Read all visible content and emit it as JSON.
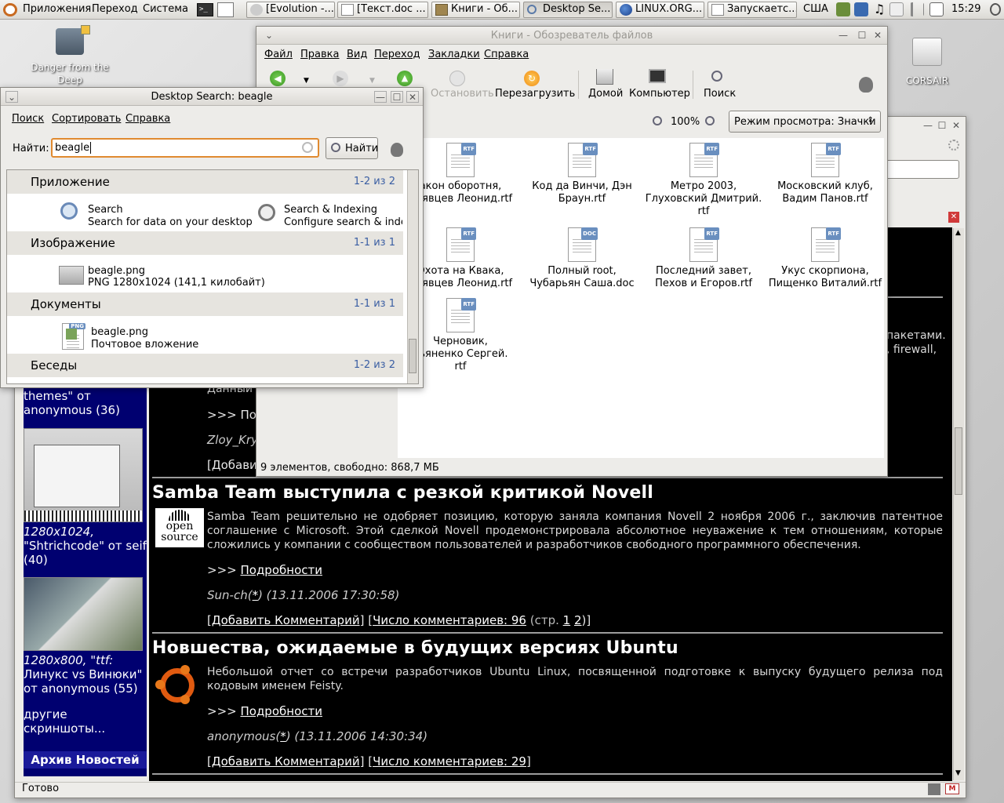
{
  "panel": {
    "menus": [
      "Приложения",
      "Переход",
      "Система"
    ],
    "tasks": [
      "[Evolution -...",
      "[Текст.doc ...",
      "Книги - Об...",
      "Desktop Se...",
      "LINUX.ORG...",
      "Запускаетс..."
    ],
    "layout": "США",
    "clock": "15:29"
  },
  "desktop": {
    "icons": [
      "Danger from the Deep",
      "CORSAIR"
    ]
  },
  "browser": {
    "status": "Готово",
    "left": {
      "t1": "themes\" от",
      "t2": "anonymous (36)",
      "t3": "1280x1024,",
      "t4": "\"Shtrichcode\" от seif",
      "t5": "(40)",
      "t6": "1280x800, \"ttf:",
      "t7": "Линукс vs Винюки\"",
      "t8": "от anonymous (55)",
      "t9": "другие скриншоты...",
      "archive": "Архив Новостей"
    },
    "frag": {
      "p1": "пакетами.",
      "p2": ", firewall,",
      "dannye": "Данный",
      "more": ">>> По",
      "author": "Zloy_Kry",
      "add": "[Добави"
    },
    "articles": [
      {
        "title": "Samba Team выступила с резкой критикой Novell",
        "logo": "open source",
        "text": "Samba Team решительно не одобряет позицию, которую заняла компания Novell 2 ноября 2006 г., заключив патентное соглашение с Microsoft. Этой сделкой Novell продемонстрировала абсолютное неуважение к тем отношениям, которые сложились у компании с сообществом пользователей и разработчиков свободного программного обеспечения.",
        "more_prefix": ">>> ",
        "more": "Подробности",
        "author": "Sun-ch",
        "star": "*",
        "date": ") (13.11.2006 17:30:58)",
        "add": "Добавить Комментарий",
        "comments": "Число комментариев: 96",
        "pages_prefix": " (стр. ",
        "p1": "1",
        "p2": "2",
        "pages_suffix": ")]"
      },
      {
        "title": "Новшества, ожидаемые в будущих версиях Ubuntu",
        "text": "Небольшой отчет со встречи разработчиков Ubuntu Linux, посвященной подготовке к выпуску будущего релиза под кодовым именем Feisty.",
        "more_prefix": ">>> ",
        "more": "Подробности",
        "author": "anonymous",
        "star": "*",
        "date": ") (13.11.2006 14:30:34)",
        "add": "Добавить Комментарий",
        "comments": "Число комментариев: 29",
        "suffix": "]"
      }
    ]
  },
  "filemanager": {
    "title": "Книги - Обозреватель файлов",
    "menu": [
      "Файл",
      "Правка",
      "Вид",
      "Переход",
      "Закладки",
      "Справка"
    ],
    "toolbar": [
      "Остановить",
      "Перезагрузить",
      "Домой",
      "Компьютер",
      "Поиск"
    ],
    "zoom": "100%",
    "view_mode": "Режим просмотра: Значки",
    "status": "9 элементов, свободно: 868,7 МБ",
    "files": [
      {
        "l1": "акон оборотня,",
        "l2": "дрявцев Леонид.rtf",
        "l3": "",
        "tag": "RTF"
      },
      {
        "l1": "Код да Винчи, Дэн",
        "l2": "Браун.rtf",
        "l3": "",
        "tag": "RTF"
      },
      {
        "l1": "Метро 2003,",
        "l2": "Глуховский Дмитрий.",
        "l3": "rtf",
        "tag": "RTF"
      },
      {
        "l1": "Московский клуб,",
        "l2": "Вадим Панов.rtf",
        "l3": "",
        "tag": "RTF"
      },
      {
        "l1": "Охота на Квака,",
        "l2": "дрявцев Леонид.rtf",
        "l3": "",
        "tag": "RTF"
      },
      {
        "l1": "Полный root,",
        "l2": "Чубарьян Саша.doc",
        "l3": "",
        "tag": "DOC"
      },
      {
        "l1": "Последний завет,",
        "l2": "Пехов и Егоров.rtf",
        "l3": "",
        "tag": "RTF"
      },
      {
        "l1": "Укус скорпиона,",
        "l2": "Пищенко Виталий.rtf",
        "l3": "",
        "tag": "RTF"
      },
      {
        "l1": "Черновик,",
        "l2": "кьяненко Сергей.",
        "l3": "rtf",
        "tag": "RTF"
      }
    ]
  },
  "search": {
    "title": "Desktop Search: beagle",
    "menu": [
      "Поиск",
      "Сортировать",
      "Справка"
    ],
    "find_label": "Найти:",
    "query": "beagle",
    "find_button": "Найти",
    "categories": [
      {
        "name": "Приложение",
        "count": "1-2 из 2"
      },
      {
        "name": "Изображение",
        "count": "1-1 из 1"
      },
      {
        "name": "Документы",
        "count": "1-1 из 1"
      },
      {
        "name": "Беседы",
        "count": "1-2 из 2"
      }
    ],
    "apps": [
      {
        "title": "Search",
        "sub": "Search for data on your desktop"
      },
      {
        "title": "Search & Indexing",
        "sub": "Configure search & indexing p"
      }
    ],
    "image": {
      "title": "beagle.png",
      "sub": "PNG 1280x1024 (141,1 килобайт)"
    },
    "doc": {
      "title": "beagle.png",
      "sub": "Почтовое вложение",
      "tag": "PNG"
    }
  }
}
